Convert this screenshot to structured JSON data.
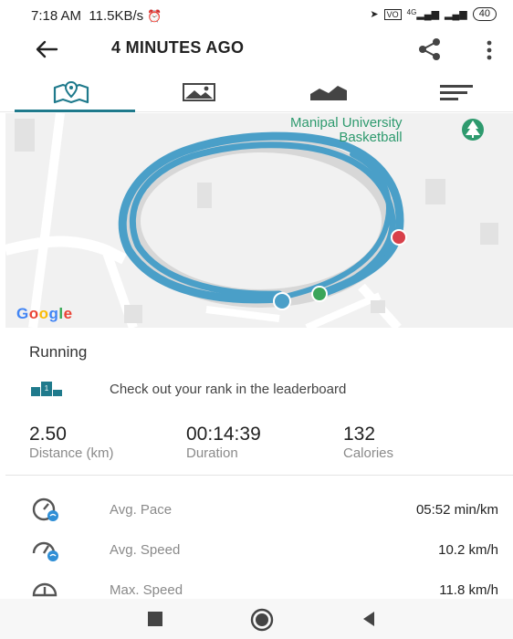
{
  "status_bar": {
    "time": "7:18 AM",
    "net_speed": "11.5KB/s",
    "signal_text": "4G",
    "battery": "40"
  },
  "header": {
    "title": "4 MINUTES AGO"
  },
  "tabs": [
    {
      "name": "map-tab-icon",
      "active": true
    },
    {
      "name": "photo-tab-icon",
      "active": false
    },
    {
      "name": "chart-tab-icon",
      "active": false
    },
    {
      "name": "details-tab-icon",
      "active": false
    }
  ],
  "map": {
    "poi_line1": "Manipal University",
    "poi_line2": "Basketball",
    "attribution": "Google",
    "route_color": "#4a9fc8"
  },
  "activity": {
    "type": "Running",
    "leaderboard_text": "Check out your rank in the leaderboard"
  },
  "stats": {
    "distance_value": "2.50",
    "distance_label": "Distance (km)",
    "duration_value": "00:14:39",
    "duration_label": "Duration",
    "calories_value": "132",
    "calories_label": "Calories"
  },
  "metrics": [
    {
      "label": "Avg. Pace",
      "value": "05:52 min/km"
    },
    {
      "label": "Avg. Speed",
      "value": "10.2 km/h"
    },
    {
      "label": "Max. Speed",
      "value": "11.8 km/h"
    }
  ],
  "colors": {
    "accent": "#1f7a8c",
    "poi_green": "#2e9a6e",
    "start_marker": "#3aa55a",
    "end_marker": "#d8404a"
  }
}
